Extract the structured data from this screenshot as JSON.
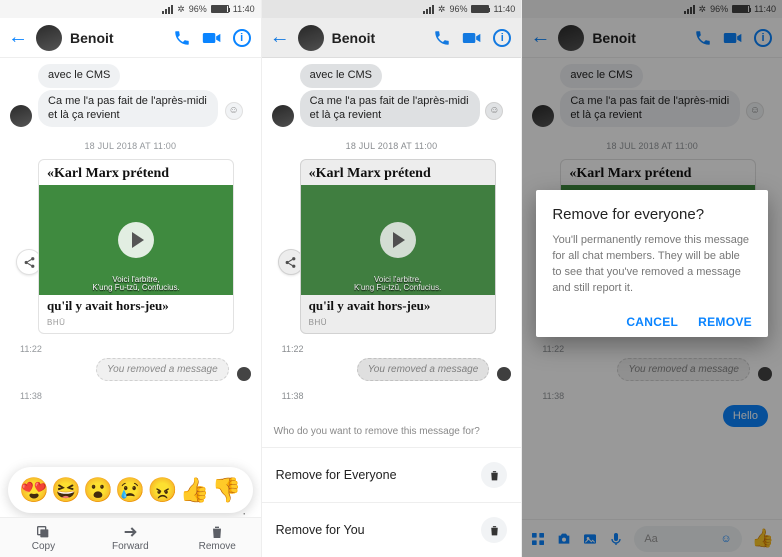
{
  "status": {
    "battery_pct": "96%",
    "time": "11:40"
  },
  "header": {
    "name": "Benoit"
  },
  "msg1": "avec le CMS",
  "msg2": "Ca me l'a pas fait de l'après-midi et là ça revient",
  "ts_card": "18 JUL 2018 AT 11:00",
  "card": {
    "title": "«Karl Marx prétend",
    "caption1": "Voici l'arbitre,",
    "caption2": "K'ung Fu-tzŭ, Confucius.",
    "subtitle": "qu'il y avait hors-jeu»",
    "source": "BHÜ"
  },
  "t1": "11:22",
  "removed_text": "You removed a message",
  "t2": "11:38",
  "hello": "Hello",
  "reactions": [
    "😍",
    "😆",
    "😮",
    "😢",
    "😠",
    "👍",
    "👎"
  ],
  "actions": {
    "copy": "Copy",
    "forward": "Forward",
    "remove": "Remove"
  },
  "sheet": {
    "question": "Who do you want to remove this message for?",
    "opt1": "Remove for Everyone",
    "opt2": "Remove for You"
  },
  "dialog": {
    "title": "Remove for everyone?",
    "body": "You'll permanently remove this message for all chat members. They will be able to see that you've removed a message and still report it.",
    "cancel": "CANCEL",
    "remove": "REMOVE"
  },
  "composer": {
    "placeholder": "Aa"
  }
}
